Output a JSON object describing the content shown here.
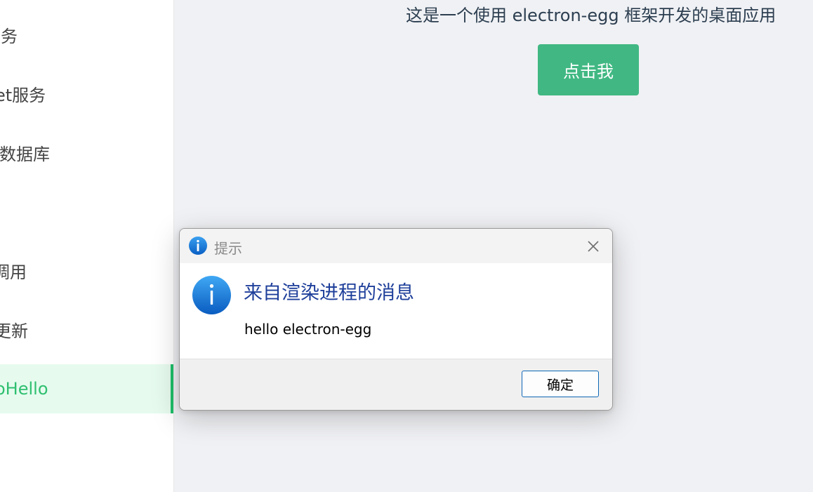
{
  "sidebar": {
    "items": [
      {
        "label": "服务"
      },
      {
        "label": "et服务"
      },
      {
        "label": "数据库"
      },
      {
        "label": "调用"
      },
      {
        "label": "更新"
      },
      {
        "label": "oHello",
        "active": true
      }
    ]
  },
  "main": {
    "intro": "这是一个使用 electron-egg 框架开发的桌面应用",
    "button_label": "点击我"
  },
  "dialog": {
    "title": "提示",
    "icon": "info-icon",
    "main_instruction": "来自渲染进程的消息",
    "content": "hello electron-egg",
    "ok_label": "确定"
  },
  "colors": {
    "accent": "#41b883",
    "active_menu_text": "#2fbf70",
    "active_menu_bg": "#e6fbee",
    "dialog_heading": "#1e3f9a",
    "ok_border": "#0f67b5"
  }
}
